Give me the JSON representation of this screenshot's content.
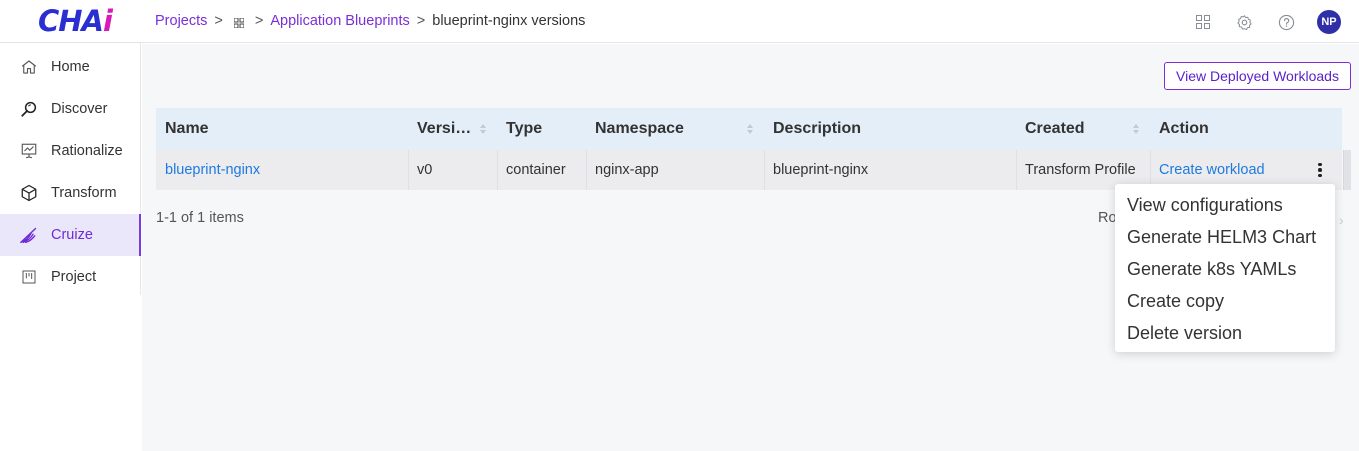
{
  "logo": {
    "part1": "CHA",
    "part2": "i"
  },
  "breadcrumb": {
    "projects": "Projects",
    "sep": ">",
    "app_blueprints": "Application Blueprints",
    "current": "blueprint-nginx versions"
  },
  "header": {
    "avatar_initials": "NP",
    "icons": [
      "apps-grid-icon",
      "gear-icon",
      "help-icon"
    ]
  },
  "sidebar": {
    "items": [
      {
        "label": "Home",
        "icon": "home-icon"
      },
      {
        "label": "Discover",
        "icon": "magnifier-icon"
      },
      {
        "label": "Rationalize",
        "icon": "chart-board-icon"
      },
      {
        "label": "Transform",
        "icon": "cube-icon"
      },
      {
        "label": "Cruize",
        "icon": "wing-icon",
        "active": true
      },
      {
        "label": "Project",
        "icon": "board-icon"
      }
    ]
  },
  "actions": {
    "view_deployed": "View Deployed Workloads"
  },
  "table": {
    "columns": [
      "Name",
      "Versi…",
      "Type",
      "Namespace",
      "Description",
      "Created",
      "Action"
    ],
    "rows": [
      {
        "name": "blueprint-nginx",
        "version": "v0",
        "type": "container",
        "namespace": "nginx-app",
        "description": "blueprint-nginx",
        "created": "Transform Profile",
        "action": "Create workload"
      }
    ]
  },
  "pagination": {
    "count": "1-1 of 1 items",
    "rows_label": "Ro"
  },
  "menu": {
    "items": [
      "View configurations",
      "Generate HELM3 Chart",
      "Generate k8s YAMLs",
      "Create copy",
      "Delete version"
    ]
  },
  "colors": {
    "accent": "#7b2fd6",
    "link": "#1f7ae0",
    "header_bg": "#e4eef9"
  }
}
